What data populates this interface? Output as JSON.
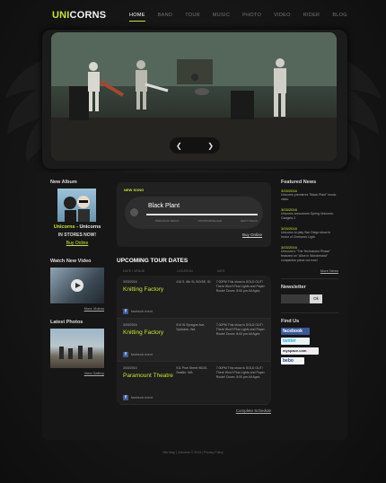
{
  "brand": {
    "logo_highlight": "UNI",
    "logo_rest": "CORNS",
    "accent": "#c9e52b"
  },
  "nav": [
    "HOME",
    "BAND",
    "TOUR",
    "MUSIC",
    "PHOTO",
    "VIDEO",
    "RIDER",
    "BLOG"
  ],
  "hero": {
    "prev_icon": "chevron-left-icon",
    "next_icon": "chevron-right-icon",
    "prev_glyph": "❮",
    "next_glyph": "❯"
  },
  "album": {
    "section_title": "New Album",
    "artist": "Unicorns",
    "separator": " - ",
    "title": "Unicorns",
    "status": "IN STORES NOW!",
    "link": "Buy Online"
  },
  "video": {
    "section_title": "Watch New Video",
    "link": "More Videos"
  },
  "photos": {
    "section_title": "Latest Photos",
    "link": "View Gallery"
  },
  "new_song": {
    "label": "NEW SONG",
    "title": "Black Plant",
    "progress": 1.0,
    "prev_track": "PREVIOUS TRACK",
    "stop_download": "STOP/DOWNLOAD",
    "next_track": "NEXT TRACK",
    "buy": "Buy Online"
  },
  "tour": {
    "title": "UPCOMING TOUR DATES",
    "headers": [
      "DATE / VENUE",
      "LOCATION",
      "INFO"
    ],
    "rows": [
      {
        "date": "3/03/2016",
        "venue": "Knitting Factory",
        "location": "416 S. 6th St, BOISE, ID",
        "info": "7:00PM This show is SOLD OUT! There Won't Plus Lights and Paper Route! Doors: 8:00 pm All Ages",
        "event": "facebook event"
      },
      {
        "date": "3/03/2016",
        "venue": "Knitting Factory",
        "location": "919 W Sprague Ave, Spokane, WA",
        "info": "7:00PM This show is SOLD OUT! There Won't Plus Lights and Paper Route! Doors: 8:00 pm All Ages",
        "event": "facebook event"
      },
      {
        "date": "3/03/2016",
        "venue": "Paramount Theatre",
        "location": "911 Pine Street 98101 Seattle, WA",
        "info": "7:00PM This show is SOLD OUT! There Won't Plus Lights and Paper Route! Doors: 8:00 pm All Ages",
        "event": "facebook event"
      }
    ],
    "complete": "Complete Schedule"
  },
  "news": {
    "section_title": "Featured News",
    "items": [
      {
        "date": "3/03/2016",
        "text": "Unicorns premieres \"Black Plant\" music video"
      },
      {
        "date": "3/03/2016",
        "text": "Unicorns announces Spring Unicorns: Gadgets 2"
      },
      {
        "date": "3/03/2016",
        "text": "Unicorns to play San Diego show in honor of Chelsea's Light"
      },
      {
        "date": "3/03/2016",
        "text": "Unicorns's \"The Technicolor Phase\" featured on \"Alice in Wonderland\" companion piece out now!"
      }
    ],
    "more": "More News"
  },
  "newsletter": {
    "section_title": "Newsletter",
    "button": "Ok"
  },
  "find_us": {
    "section_title": "Find Us",
    "links": [
      "facebook",
      "twitter",
      "myspace.com",
      "bebo"
    ]
  },
  "footer": {
    "text": "Site Map | Unicorns © 2013 | Privacy Policy"
  }
}
